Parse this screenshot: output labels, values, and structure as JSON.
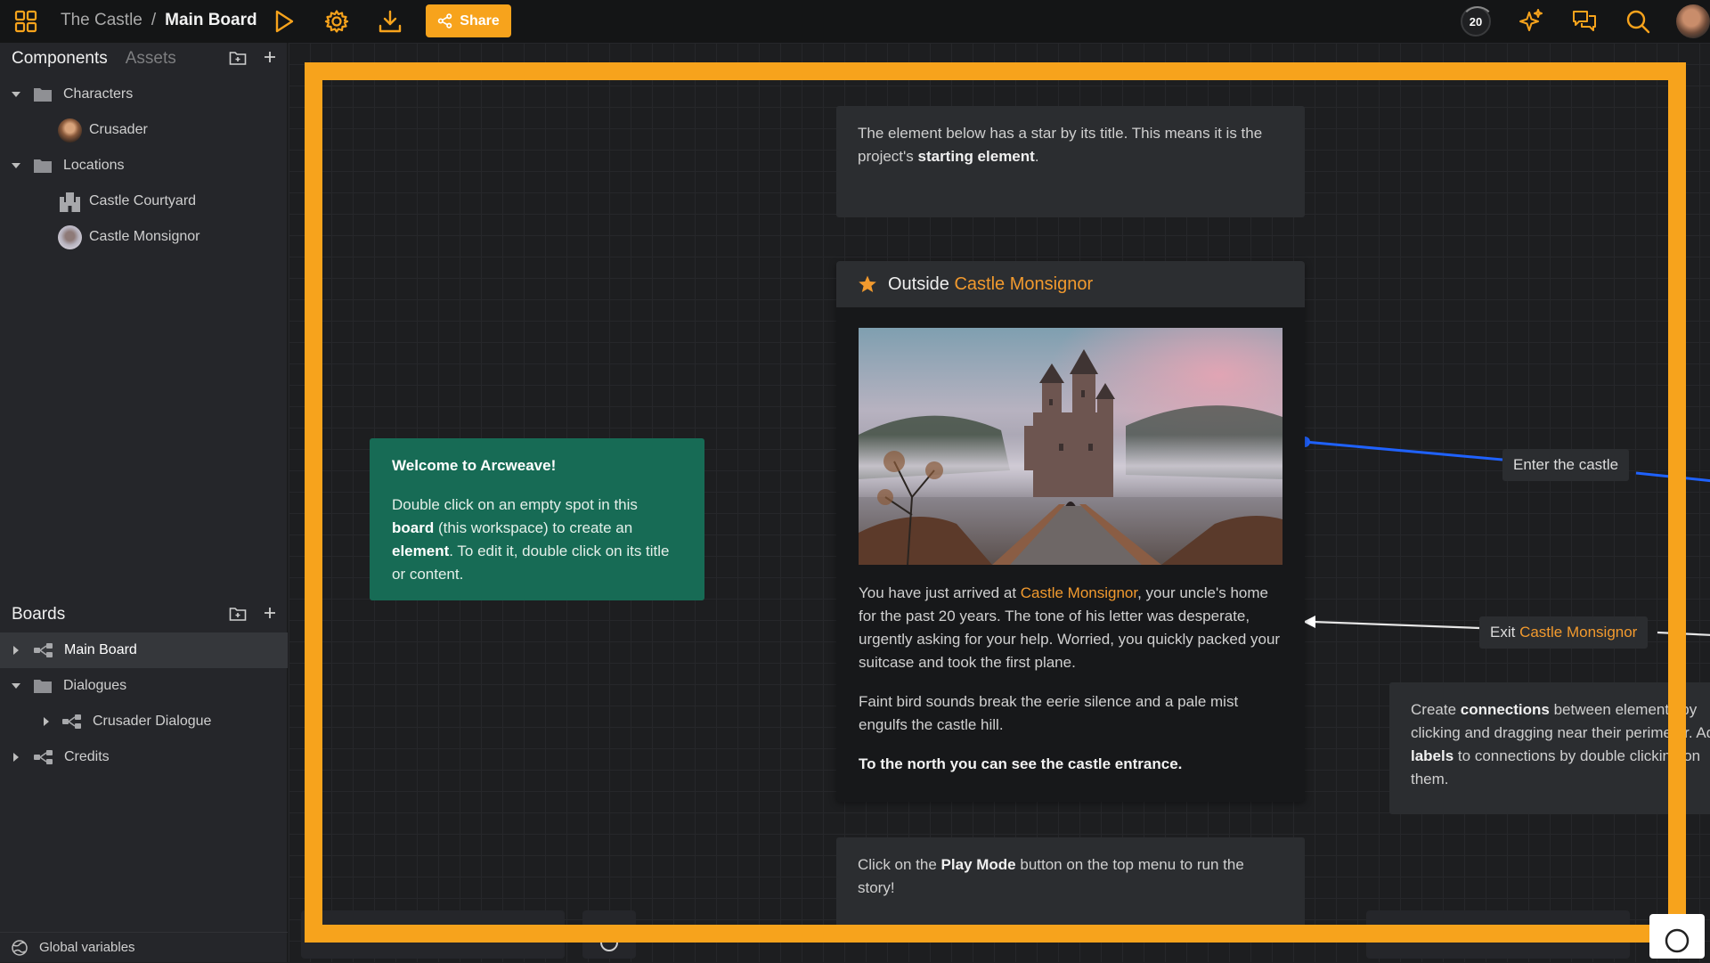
{
  "topbar": {
    "project_name": "The Castle",
    "separator": "/",
    "board_name": "Main Board",
    "share_label": "Share",
    "credits_count": "20"
  },
  "sidebar": {
    "components_tab": "Components",
    "assets_tab": "Assets",
    "components_tree": [
      {
        "label": "Characters",
        "type": "folder"
      },
      {
        "label": "Crusader",
        "type": "character"
      },
      {
        "label": "Locations",
        "type": "folder"
      },
      {
        "label": "Castle Courtyard",
        "type": "location"
      },
      {
        "label": "Castle Monsignor",
        "type": "location"
      }
    ],
    "boards_title": "Boards",
    "boards_tree": [
      {
        "label": "Main Board",
        "type": "board"
      },
      {
        "label": "Dialogues",
        "type": "folder"
      },
      {
        "label": "Crusader Dialogue",
        "type": "board"
      },
      {
        "label": "Credits",
        "type": "board"
      }
    ],
    "global_variables": "Global variables"
  },
  "board": {
    "note_top": {
      "text_1": "The element below has a star by its title. This means it is the project's ",
      "bold": "starting element",
      "text_2": "."
    },
    "welcome": {
      "title": "Welcome to Arcweave!",
      "t1": "Double click on an empty spot in this ",
      "b1": "board",
      "t2": " (this workspace) to create an ",
      "b2": "element",
      "t3": ". To edit it, double click on its title or content."
    },
    "element": {
      "title_prefix": "Outside ",
      "title_link": "Castle Monsignor",
      "p1_a": "You have just arrived at ",
      "p1_link": "Castle Monsignor",
      "p1_b": ", your uncle's home for the past 20 years. The tone of his letter was desperate, urgently asking for your help. Worried, you quickly packed your suitcase and took the first plane.",
      "p2": "Faint bird sounds break the eerie silence and a pale mist engulfs the castle hill.",
      "p3": "To the north you can see the castle entrance."
    },
    "connection_enter": "Enter the castle",
    "connection_exit_prefix": "Exit ",
    "connection_exit_link": "Castle Monsignor",
    "note_connections": {
      "t1": "Create ",
      "b1": "connections",
      "t2": " between elements by clicking and dragging near their perimeter. Add ",
      "b2": "labels",
      "t3": " to connections by double clicking on them."
    },
    "note_bottom": {
      "t1": "Click on the ",
      "b1": "Play Mode",
      "t2": " button on the top menu to run the story!"
    }
  },
  "colors": {
    "accent": "#f7a31c",
    "welcome_bg": "#176b55",
    "connection_blue": "#1f62ff",
    "link_orange": "#f29a2e"
  }
}
